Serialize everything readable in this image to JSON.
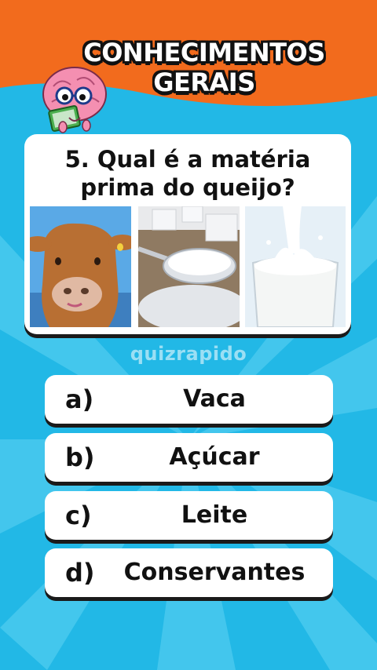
{
  "header": {
    "title_line1": "CONHECIMENTOS",
    "title_line2": "GERAIS",
    "mascot_icon": "brain-reading-book-icon"
  },
  "question": {
    "text": "5. Qual é a matéria prima do queijo?",
    "images": [
      "cow-photo",
      "sugar-spoon-photo",
      "milk-glass-photo"
    ]
  },
  "watermark": "quizrapido",
  "options": [
    {
      "letter": "a)",
      "text": "Vaca"
    },
    {
      "letter": "b)",
      "text": "Açúcar"
    },
    {
      "letter": "c)",
      "text": "Leite"
    },
    {
      "letter": "d)",
      "text": "Conservantes"
    }
  ],
  "colors": {
    "header_orange": "#f26b1d",
    "background_blue": "#29c0ea",
    "card_white": "#ffffff",
    "text_dark": "#111111"
  }
}
